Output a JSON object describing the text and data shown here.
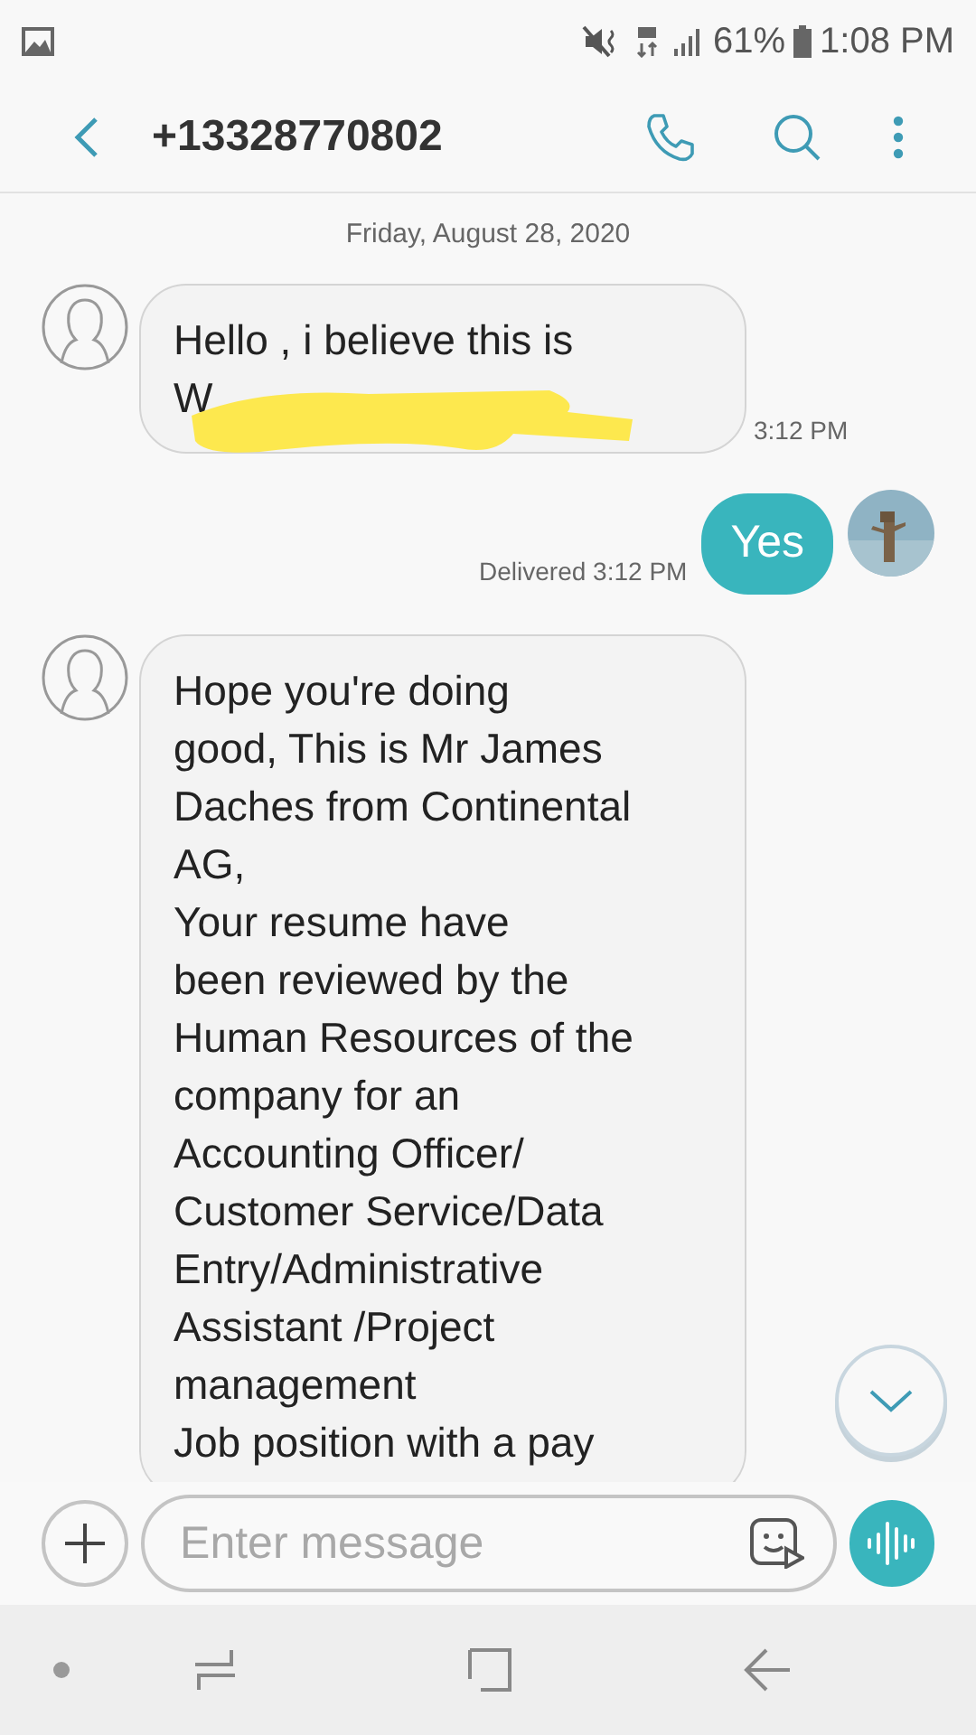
{
  "status_bar": {
    "battery": "61%",
    "time": "1:08 PM"
  },
  "header": {
    "title": "+13328770802"
  },
  "date": "Friday, August 28, 2020",
  "messages": [
    {
      "kind": "incoming",
      "text": "Hello , i believe this is\nW",
      "redacted": true,
      "time": "3:12 PM"
    },
    {
      "kind": "outgoing",
      "text": "Yes",
      "status": "Delivered 3:12 PM"
    },
    {
      "kind": "incoming",
      "text": "Hope you're doing\ngood, This is Mr James\nDaches from Continental\nAG,\nYour resume have\nbeen reviewed by the\nHuman Resources of the\ncompany for an\nAccounting Officer/\nCustomer Service/Data\nEntry/Administrative\nAssistant /Project\nmanagement\nJob position with a pay",
      "redacted": false
    }
  ],
  "composer": {
    "placeholder": "Enter message"
  }
}
